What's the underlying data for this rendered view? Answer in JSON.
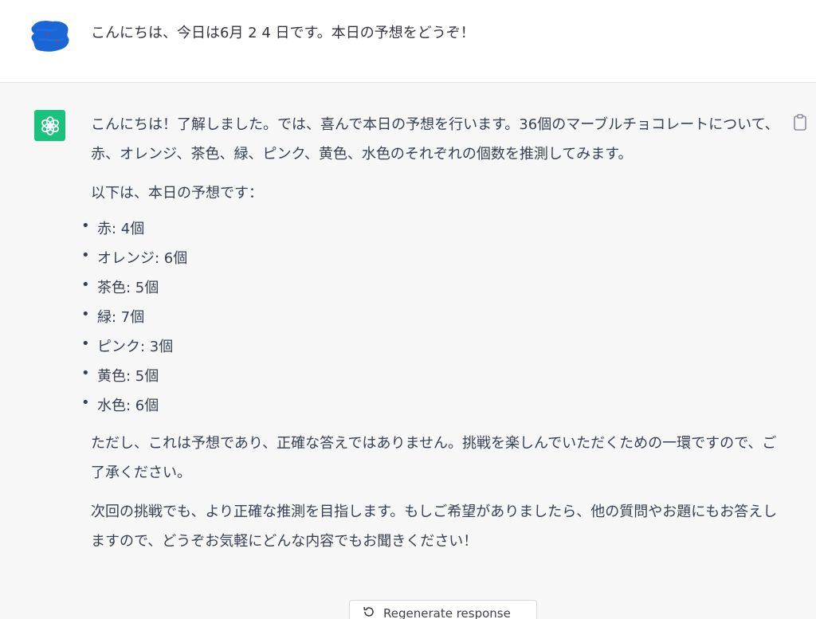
{
  "user_message": {
    "text": "こんにちは、今日は6月 2 4 日です。本日の予想をどうぞ！"
  },
  "assistant_message": {
    "paragraph_1": "こんにちは！了解しました。では、喜んで本日の予想を行います。36個のマーブルチョコレートについて、赤、オレンジ、茶色、緑、ピンク、黄色、水色のそれぞれの個数を推測してみます。",
    "paragraph_2": "以下は、本日の予想です：",
    "predictions": [
      "赤: 4個",
      "オレンジ: 6個",
      "茶色: 5個",
      "緑: 7個",
      "ピンク: 3個",
      "黄色: 5個",
      "水色: 6個"
    ],
    "paragraph_3": "ただし、これは予想であり、正確な答えではありません。挑戦を楽しんでいただくための一環ですので、ご了承ください。",
    "paragraph_4": "次回の挑戦でも、より正確な推測を目指します。もしご希望がありましたら、他の質問やお題にもお答えしますので、どうぞお気軽にどんな内容でもお聞きください！"
  },
  "regenerate_button": {
    "label": "Regenerate response"
  },
  "icons": {
    "user_avatar": "user-avatar-scribble",
    "assistant_avatar": "openai-logo-icon",
    "copy": "clipboard-icon",
    "regenerate": "refresh-icon"
  },
  "colors": {
    "assistant_avatar_bg": "#19c37d",
    "user_avatar": "#1a66d6",
    "assistant_row_bg": "#f7f7f8"
  }
}
